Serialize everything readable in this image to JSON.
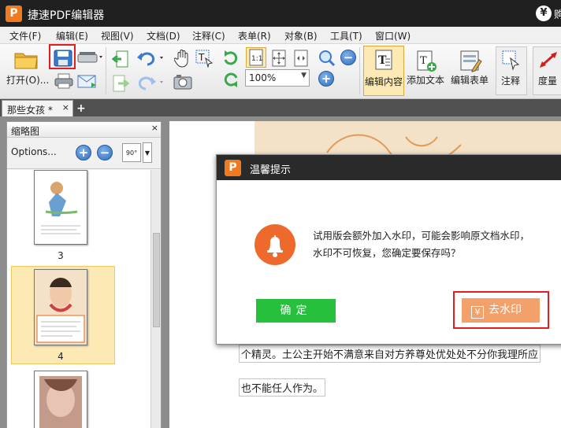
{
  "app": {
    "logo_letter": "P",
    "title": "捷速PDF编辑器",
    "right_cut_text": "购",
    "yen_symbol": "¥"
  },
  "menu": [
    "文件(F)",
    "编辑(E)",
    "视图(V)",
    "文档(D)",
    "注释(C)",
    "表单(R)",
    "对象(B)",
    "工具(T)",
    "窗口(W)"
  ],
  "toolbar": {
    "open_label": "打开(O)...",
    "zoom_value": "100%",
    "zoom_fit_label": "1:1",
    "edit_content_label": "编辑内容",
    "add_text_label": "添加文本",
    "edit_form_label": "编辑表单",
    "annotate_label": "注释",
    "measure_label": "度量"
  },
  "tabs": [
    {
      "label": "那些女孩 *",
      "close": "×"
    }
  ],
  "add_tab": "+",
  "sidebar": {
    "title": "缩略图",
    "close": "×",
    "options_label": "Options...",
    "rotate_label": "90°",
    "pages": [
      "3",
      "4"
    ]
  },
  "document": {
    "line1": "个精灵。土公主开始不满意来自对方养尊处优处处不分你我理所应",
    "line2": "也不能任人作为。"
  },
  "dialog": {
    "logo_letter": "P",
    "title": "温馨提示",
    "message_line1": "试用版会额外加入水印，可能会影响原文档水印，",
    "message_line2": "水印不可恢复，您确定要保存吗？",
    "ok_label": "确定",
    "remove_watermark_label": "去水印",
    "yen_symbol": "¥"
  },
  "colors": {
    "accent_orange": "#f07a20",
    "ok_green": "#26c03c",
    "watermark_button": "#f2a16a",
    "highlight_red": "#e02020"
  }
}
